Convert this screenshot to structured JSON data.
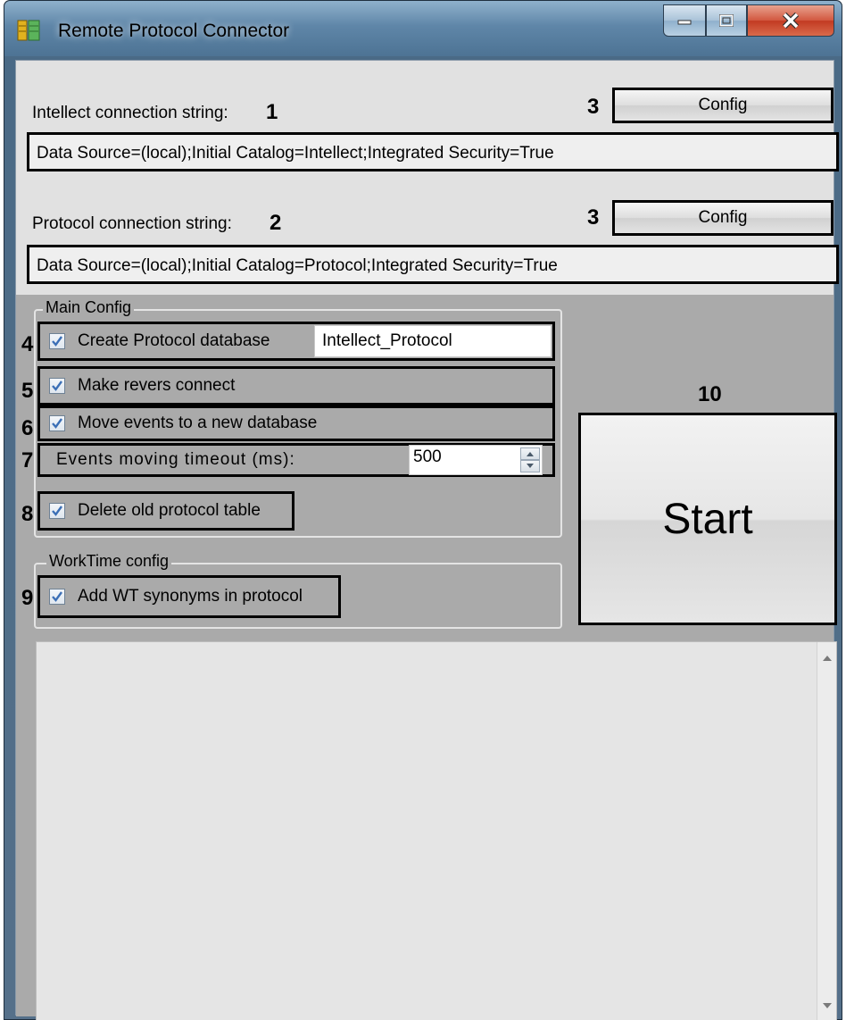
{
  "window": {
    "title": "Remote Protocol Connector",
    "controls": {
      "minimize": "minimize-icon",
      "maximize": "maximize-icon",
      "close": "close-icon"
    }
  },
  "intellect": {
    "label": "Intellect connection string:",
    "callout": "1",
    "value": "Data Source=(local);Initial Catalog=Intellect;Integrated Security=True",
    "config_callout": "3",
    "config_label": "Config"
  },
  "protocol": {
    "label": "Protocol connection string:",
    "callout": "2",
    "value": "Data Source=(local);Initial Catalog=Protocol;Integrated Security=True",
    "config_callout": "3",
    "config_label": "Config"
  },
  "main_config": {
    "title": "Main Config",
    "create_db": {
      "callout": "4",
      "label": "Create Protocol database",
      "checked": true,
      "db_name": "Intellect_Protocol"
    },
    "reverse_connect": {
      "callout": "5",
      "label": "Make revers connect",
      "checked": true
    },
    "move_events": {
      "callout": "6",
      "label": "Move events to a new database",
      "checked": true
    },
    "timeout": {
      "callout": "7",
      "label": "Events moving timeout (ms):",
      "value": "500"
    },
    "delete_old": {
      "callout": "8",
      "label": "Delete old protocol table",
      "checked": true
    }
  },
  "worktime": {
    "title": "WorkTime config",
    "add_synonyms": {
      "callout": "9",
      "label": "Add WT synonyms in protocol",
      "checked": true
    }
  },
  "start": {
    "callout": "10",
    "label": "Start"
  },
  "colors": {
    "check": "#3b6fb6",
    "client_upper": "#e1e1e1",
    "client_lower": "#aaaaaa"
  }
}
